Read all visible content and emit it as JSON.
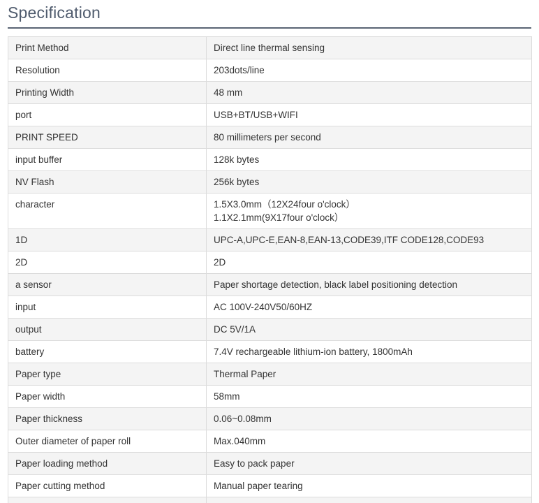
{
  "heading": "Specification",
  "rows": [
    {
      "label": "Print Method",
      "value": [
        "Direct line thermal sensing"
      ]
    },
    {
      "label": "Resolution",
      "value": [
        "203dots/line"
      ]
    },
    {
      "label": "Printing Width",
      "value": [
        "48 mm"
      ]
    },
    {
      "label": "port",
      "value": [
        "USB+BT/USB+WIFI"
      ]
    },
    {
      "label": "PRINT SPEED",
      "value": [
        "80 millimeters per second"
      ]
    },
    {
      "label": "input buffer",
      "value": [
        "128k bytes"
      ]
    },
    {
      "label": "NV Flash",
      "value": [
        "256k bytes"
      ]
    },
    {
      "label": "character",
      "value": [
        "1.5X3.0mm（12X24four o'clock）",
        "1.1X2.1mm(9X17four o'clock）"
      ]
    },
    {
      "label": "1D",
      "value": [
        "UPC-A,UPC-E,EAN-8,EAN-13,CODE39,ITF CODE128,CODE93"
      ]
    },
    {
      "label": "2D",
      "value": [
        "2D"
      ]
    },
    {
      "label": "a sensor",
      "value": [
        "Paper shortage detection, black label positioning detection"
      ]
    },
    {
      "label": "input",
      "value": [
        "AC 100V-240V50/60HZ"
      ]
    },
    {
      "label": "output",
      "value": [
        "DC 5V/1A"
      ]
    },
    {
      "label": "battery",
      "value": [
        "7.4V rechargeable lithium-ion battery, 1800mAh"
      ]
    },
    {
      "label": "Paper type",
      "value": [
        "Thermal Paper"
      ]
    },
    {
      "label": "Paper width",
      "value": [
        "58mm"
      ]
    },
    {
      "label": "Paper thickness",
      "value": [
        "0.06~0.08mm"
      ]
    },
    {
      "label": "Outer diameter of paper roll",
      "value": [
        "Max.040mm"
      ]
    },
    {
      "label": "Paper loading method",
      "value": [
        "Easy to pack paper"
      ]
    },
    {
      "label": "Paper cutting method",
      "value": [
        "Manual paper tearing"
      ]
    },
    {
      "label": "",
      "value": [
        ""
      ]
    }
  ]
}
